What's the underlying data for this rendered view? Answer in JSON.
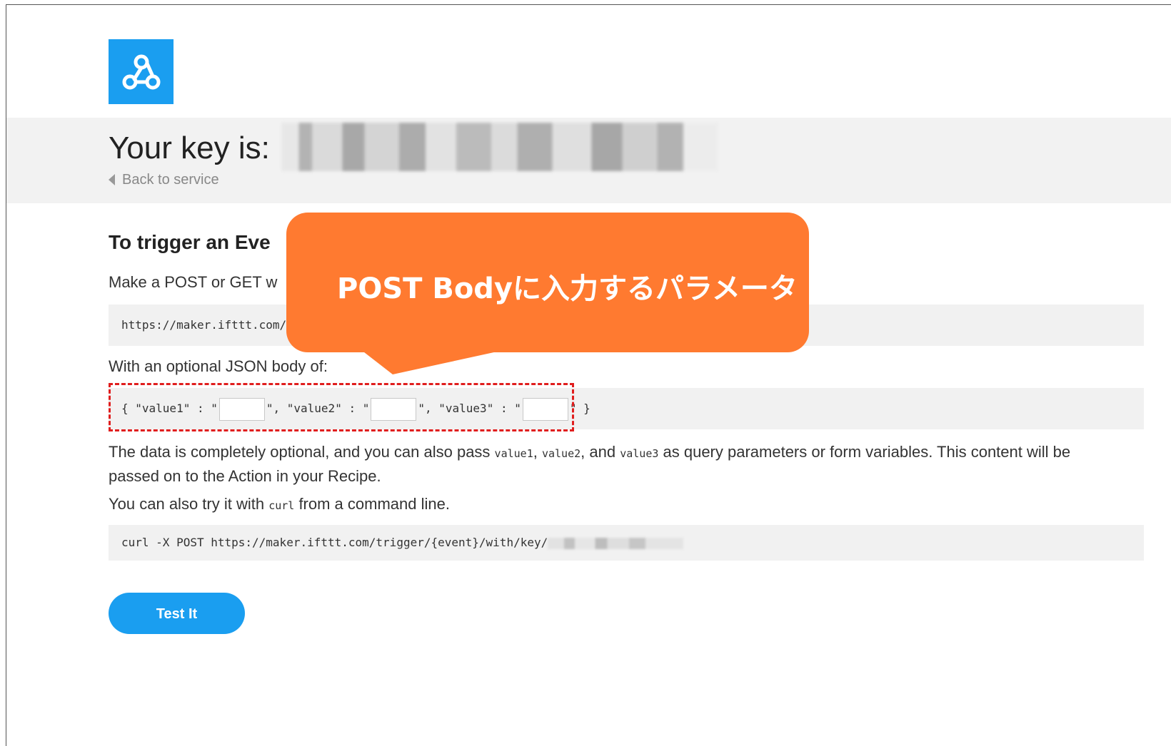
{
  "header": {
    "key_label": "Your key is:",
    "back_link": "Back to service"
  },
  "content": {
    "heading": "To trigger an Eve",
    "make_request_text": "Make a POST or GET w",
    "url_partial": "https://maker.ifttt.com/tr",
    "json_intro": "With an optional JSON body of:",
    "json_body": {
      "part1": "{ \"value1\" : \"",
      "part2": "\", \"value2\" : \"",
      "part3": "\", \"value3\" : \"",
      "part4": "\" }"
    },
    "optional_text": {
      "a": "The data is completely optional, and you can also pass ",
      "v1": "value1",
      "comma1": ", ",
      "v2": "value2",
      "and": ", and ",
      "v3": "value3",
      "b": " as query parameters or form variables. This content will be",
      "line2": "passed on to the Action in your Recipe."
    },
    "curl_text": {
      "a": "You can also try it with ",
      "cmd": "curl",
      "b": " from a command line."
    },
    "curl_command": "curl -X POST https://maker.ifttt.com/trigger/{event}/with/key/",
    "test_button": "Test It"
  },
  "callout": {
    "text": "POST Bodyに入力するパラメータ",
    "color": "#ff7a30"
  },
  "colors": {
    "brand_blue": "#1a9ef0",
    "highlight_red": "#e01e1e"
  },
  "icons": {
    "logo": "webhooks-icon",
    "back": "triangle-left-icon"
  }
}
